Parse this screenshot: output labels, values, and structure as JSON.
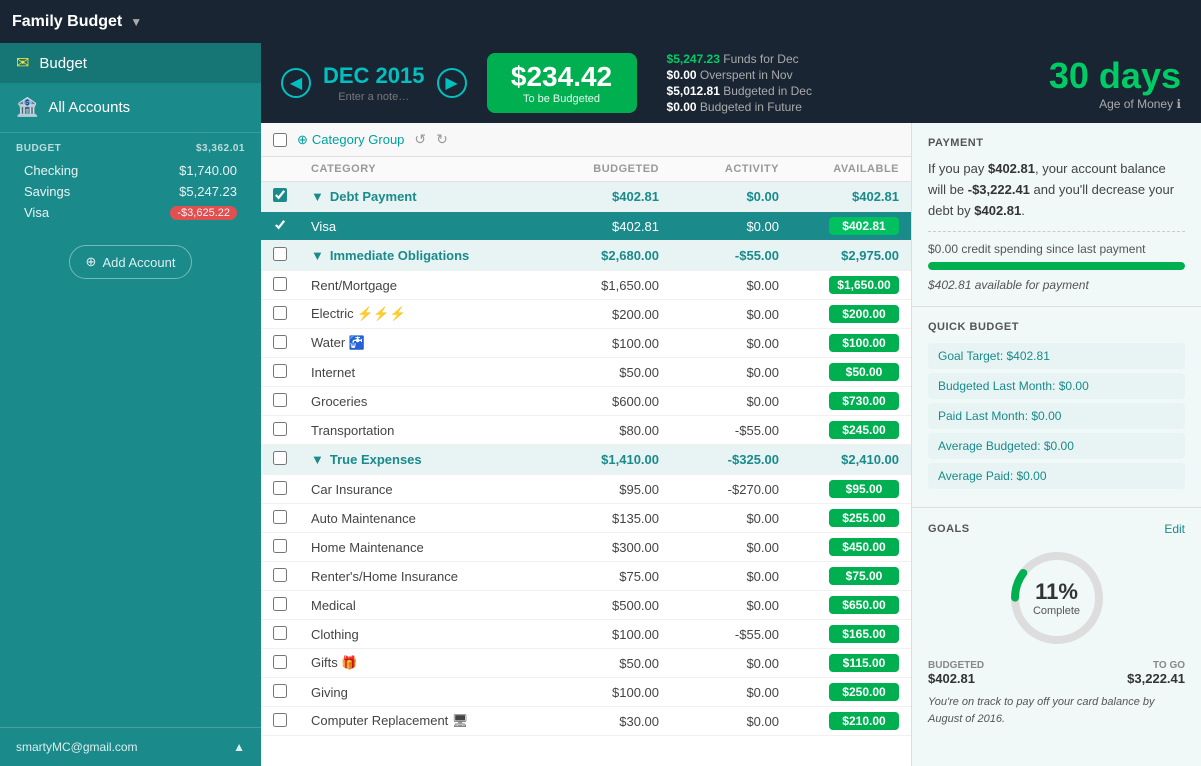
{
  "app": {
    "title": "Family Budget",
    "dropdown_icon": "▼"
  },
  "header": {
    "month": "DEC 2015",
    "month_note": "Enter a note…",
    "to_budget_amount": "$234.42",
    "to_budget_label": "To be Budgeted",
    "stats": [
      {
        "label": "Funds for Dec",
        "value": "$5,247.23",
        "color": "green"
      },
      {
        "label": "Overspent in Nov",
        "value": "$0.00",
        "color": "white"
      },
      {
        "label": "Budgeted in Dec",
        "value": "$5,012.81",
        "color": "white"
      },
      {
        "label": "Budgeted in Future",
        "value": "$0.00",
        "color": "white"
      }
    ],
    "age_of_money": "30 days",
    "age_label": "Age of Money ℹ"
  },
  "sidebar": {
    "budget_label": "Budget",
    "all_accounts_label": "All Accounts",
    "accounts_group": "BUDGET",
    "accounts_group_total": "$3,362.01",
    "accounts": [
      {
        "name": "Checking",
        "balance": "$1,740.00",
        "negative": false
      },
      {
        "name": "Savings",
        "balance": "$5,247.23",
        "negative": false
      },
      {
        "name": "Visa",
        "balance": "-$3,625.22",
        "negative": true
      }
    ],
    "add_account_label": "Add Account",
    "footer_email": "smartyMC@gmail.com"
  },
  "toolbar": {
    "category_group_label": "Category Group"
  },
  "table": {
    "columns": [
      "CATEGORY",
      "BUDGETED",
      "ACTIVITY",
      "AVAILABLE"
    ],
    "groups": [
      {
        "name": "Debt Payment",
        "budgeted": "$402.81",
        "activity": "$0.00",
        "available": "$402.81",
        "checked": true,
        "items": [
          {
            "name": "Visa",
            "budgeted": "$402.81",
            "activity": "$0.00",
            "available": "$402.81",
            "checked": true
          }
        ]
      },
      {
        "name": "Immediate Obligations",
        "budgeted": "$2,680.00",
        "activity": "-$55.00",
        "available": "$2,975.00",
        "checked": false,
        "items": [
          {
            "name": "Rent/Mortgage",
            "budgeted": "$1,650.00",
            "activity": "$0.00",
            "available": "$1,650.00",
            "checked": false
          },
          {
            "name": "Electric ⚡⚡⚡",
            "budgeted": "$200.00",
            "activity": "$0.00",
            "available": "$200.00",
            "checked": false
          },
          {
            "name": "Water 🚰",
            "budgeted": "$100.00",
            "activity": "$0.00",
            "available": "$100.00",
            "checked": false
          },
          {
            "name": "Internet",
            "budgeted": "$50.00",
            "activity": "$0.00",
            "available": "$50.00",
            "checked": false
          },
          {
            "name": "Groceries",
            "budgeted": "$600.00",
            "activity": "$0.00",
            "available": "$730.00",
            "checked": false
          },
          {
            "name": "Transportation",
            "budgeted": "$80.00",
            "activity": "-$55.00",
            "available": "$245.00",
            "checked": false
          }
        ]
      },
      {
        "name": "True Expenses",
        "budgeted": "$1,410.00",
        "activity": "-$325.00",
        "available": "$2,410.00",
        "checked": false,
        "items": [
          {
            "name": "Car Insurance",
            "budgeted": "$95.00",
            "activity": "-$270.00",
            "available": "$95.00",
            "checked": false
          },
          {
            "name": "Auto Maintenance",
            "budgeted": "$135.00",
            "activity": "$0.00",
            "available": "$255.00",
            "checked": false
          },
          {
            "name": "Home Maintenance",
            "budgeted": "$300.00",
            "activity": "$0.00",
            "available": "$450.00",
            "checked": false
          },
          {
            "name": "Renter's/Home Insurance",
            "budgeted": "$75.00",
            "activity": "$0.00",
            "available": "$75.00",
            "checked": false
          },
          {
            "name": "Medical",
            "budgeted": "$500.00",
            "activity": "$0.00",
            "available": "$650.00",
            "checked": false
          },
          {
            "name": "Clothing",
            "budgeted": "$100.00",
            "activity": "-$55.00",
            "available": "$165.00",
            "checked": false
          },
          {
            "name": "Gifts 🎁",
            "budgeted": "$50.00",
            "activity": "$0.00",
            "available": "$115.00",
            "checked": false
          },
          {
            "name": "Giving",
            "budgeted": "$100.00",
            "activity": "$0.00",
            "available": "$250.00",
            "checked": false
          },
          {
            "name": "Computer Replacement 🖥",
            "budgeted": "$30.00",
            "activity": "$0.00",
            "available": "$210.00",
            "checked": false
          }
        ]
      }
    ]
  },
  "right_panel": {
    "payment": {
      "title": "PAYMENT",
      "text_part1": "If you pay ",
      "amount": "$402.81",
      "text_part2": ", your account balance will be ",
      "balance": "-$3,222.41",
      "text_part3": " and you'll decrease your debt by ",
      "decrease": "$402.81",
      "text_part4": ".",
      "credit_text": "$0.00 credit spending since last payment",
      "progress_pct": 100,
      "avail_text": "$402.81 available for payment"
    },
    "quick_budget": {
      "title": "QUICK BUDGET",
      "rows": [
        {
          "label": "Goal Target: $402.81"
        },
        {
          "label": "Budgeted Last Month: $0.00"
        },
        {
          "label": "Paid Last Month: $0.00"
        },
        {
          "label": "Average Budgeted: $0.00"
        },
        {
          "label": "Average Paid: $0.00"
        }
      ]
    },
    "goals": {
      "title": "GOALS",
      "edit_label": "Edit",
      "percent": "11",
      "complete_label": "Complete",
      "budgeted_label": "BUDGETED",
      "budgeted_value": "$402.81",
      "to_go_label": "TO GO",
      "to_go_value": "$3,222.41",
      "track_text": "You're on track to pay off your card balance by August of 2016."
    }
  }
}
